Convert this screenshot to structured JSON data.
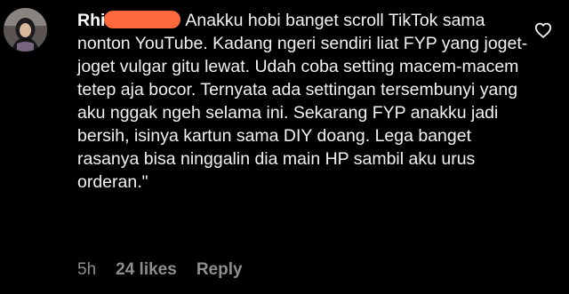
{
  "comment": {
    "username": "Rhi",
    "text": "Anakku hobi banget scroll TikTok sama nonton YouTube. Kadang ngeri sendiri liat FYP yang joget-joget vulgar gitu lewat. Udah coba setting macem-macem tetep aja bocor. Ternyata ada settingan tersembunyi yang aku nggak ngeh selama ini. Sekarang FYP anakku jadi bersih, isinya kartun sama DIY doang. Lega banget rasanya bisa ninggalin dia main HP sambil aku urus orderan.\"",
    "time": "5h",
    "likes": "24 likes",
    "reply_label": "Reply"
  },
  "colors": {
    "background": "#000000",
    "text": "#f2f2f2",
    "meta": "#8e8e8e",
    "redaction": "#ff6a3d"
  },
  "icons": {
    "like": "heart-outline-icon",
    "avatar": "profile-photo"
  }
}
